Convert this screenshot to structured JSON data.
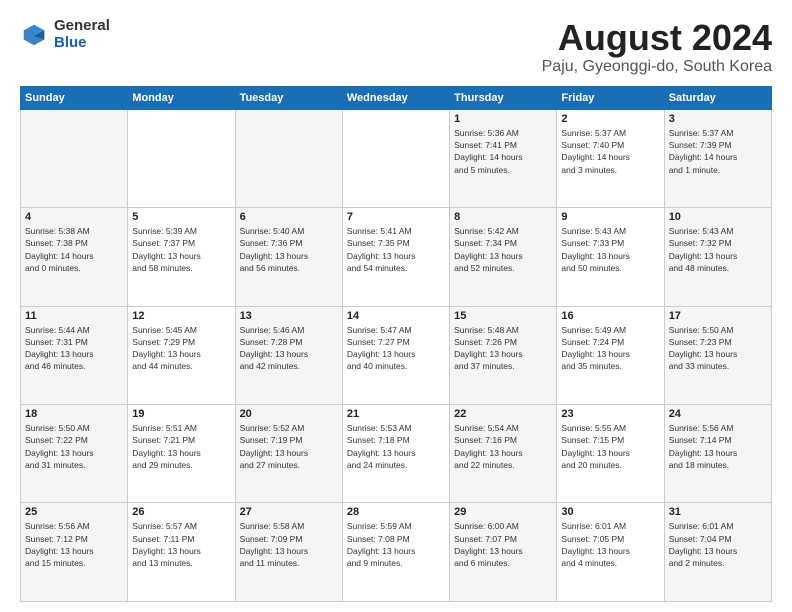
{
  "logo": {
    "general": "General",
    "blue": "Blue"
  },
  "title": "August 2024",
  "subtitle": "Paju, Gyeonggi-do, South Korea",
  "days_header": [
    "Sunday",
    "Monday",
    "Tuesday",
    "Wednesday",
    "Thursday",
    "Friday",
    "Saturday"
  ],
  "weeks": [
    [
      {
        "day": "",
        "info": ""
      },
      {
        "day": "",
        "info": ""
      },
      {
        "day": "",
        "info": ""
      },
      {
        "day": "",
        "info": ""
      },
      {
        "day": "1",
        "info": "Sunrise: 5:36 AM\nSunset: 7:41 PM\nDaylight: 14 hours\nand 5 minutes."
      },
      {
        "day": "2",
        "info": "Sunrise: 5:37 AM\nSunset: 7:40 PM\nDaylight: 14 hours\nand 3 minutes."
      },
      {
        "day": "3",
        "info": "Sunrise: 5:37 AM\nSunset: 7:39 PM\nDaylight: 14 hours\nand 1 minute."
      }
    ],
    [
      {
        "day": "4",
        "info": "Sunrise: 5:38 AM\nSunset: 7:38 PM\nDaylight: 14 hours\nand 0 minutes."
      },
      {
        "day": "5",
        "info": "Sunrise: 5:39 AM\nSunset: 7:37 PM\nDaylight: 13 hours\nand 58 minutes."
      },
      {
        "day": "6",
        "info": "Sunrise: 5:40 AM\nSunset: 7:36 PM\nDaylight: 13 hours\nand 56 minutes."
      },
      {
        "day": "7",
        "info": "Sunrise: 5:41 AM\nSunset: 7:35 PM\nDaylight: 13 hours\nand 54 minutes."
      },
      {
        "day": "8",
        "info": "Sunrise: 5:42 AM\nSunset: 7:34 PM\nDaylight: 13 hours\nand 52 minutes."
      },
      {
        "day": "9",
        "info": "Sunrise: 5:43 AM\nSunset: 7:33 PM\nDaylight: 13 hours\nand 50 minutes."
      },
      {
        "day": "10",
        "info": "Sunrise: 5:43 AM\nSunset: 7:32 PM\nDaylight: 13 hours\nand 48 minutes."
      }
    ],
    [
      {
        "day": "11",
        "info": "Sunrise: 5:44 AM\nSunset: 7:31 PM\nDaylight: 13 hours\nand 46 minutes."
      },
      {
        "day": "12",
        "info": "Sunrise: 5:45 AM\nSunset: 7:29 PM\nDaylight: 13 hours\nand 44 minutes."
      },
      {
        "day": "13",
        "info": "Sunrise: 5:46 AM\nSunset: 7:28 PM\nDaylight: 13 hours\nand 42 minutes."
      },
      {
        "day": "14",
        "info": "Sunrise: 5:47 AM\nSunset: 7:27 PM\nDaylight: 13 hours\nand 40 minutes."
      },
      {
        "day": "15",
        "info": "Sunrise: 5:48 AM\nSunset: 7:26 PM\nDaylight: 13 hours\nand 37 minutes."
      },
      {
        "day": "16",
        "info": "Sunrise: 5:49 AM\nSunset: 7:24 PM\nDaylight: 13 hours\nand 35 minutes."
      },
      {
        "day": "17",
        "info": "Sunrise: 5:50 AM\nSunset: 7:23 PM\nDaylight: 13 hours\nand 33 minutes."
      }
    ],
    [
      {
        "day": "18",
        "info": "Sunrise: 5:50 AM\nSunset: 7:22 PM\nDaylight: 13 hours\nand 31 minutes."
      },
      {
        "day": "19",
        "info": "Sunrise: 5:51 AM\nSunset: 7:21 PM\nDaylight: 13 hours\nand 29 minutes."
      },
      {
        "day": "20",
        "info": "Sunrise: 5:52 AM\nSunset: 7:19 PM\nDaylight: 13 hours\nand 27 minutes."
      },
      {
        "day": "21",
        "info": "Sunrise: 5:53 AM\nSunset: 7:18 PM\nDaylight: 13 hours\nand 24 minutes."
      },
      {
        "day": "22",
        "info": "Sunrise: 5:54 AM\nSunset: 7:16 PM\nDaylight: 13 hours\nand 22 minutes."
      },
      {
        "day": "23",
        "info": "Sunrise: 5:55 AM\nSunset: 7:15 PM\nDaylight: 13 hours\nand 20 minutes."
      },
      {
        "day": "24",
        "info": "Sunrise: 5:56 AM\nSunset: 7:14 PM\nDaylight: 13 hours\nand 18 minutes."
      }
    ],
    [
      {
        "day": "25",
        "info": "Sunrise: 5:56 AM\nSunset: 7:12 PM\nDaylight: 13 hours\nand 15 minutes."
      },
      {
        "day": "26",
        "info": "Sunrise: 5:57 AM\nSunset: 7:11 PM\nDaylight: 13 hours\nand 13 minutes."
      },
      {
        "day": "27",
        "info": "Sunrise: 5:58 AM\nSunset: 7:09 PM\nDaylight: 13 hours\nand 11 minutes."
      },
      {
        "day": "28",
        "info": "Sunrise: 5:59 AM\nSunset: 7:08 PM\nDaylight: 13 hours\nand 9 minutes."
      },
      {
        "day": "29",
        "info": "Sunrise: 6:00 AM\nSunset: 7:07 PM\nDaylight: 13 hours\nand 6 minutes."
      },
      {
        "day": "30",
        "info": "Sunrise: 6:01 AM\nSunset: 7:05 PM\nDaylight: 13 hours\nand 4 minutes."
      },
      {
        "day": "31",
        "info": "Sunrise: 6:01 AM\nSunset: 7:04 PM\nDaylight: 13 hours\nand 2 minutes."
      }
    ]
  ]
}
